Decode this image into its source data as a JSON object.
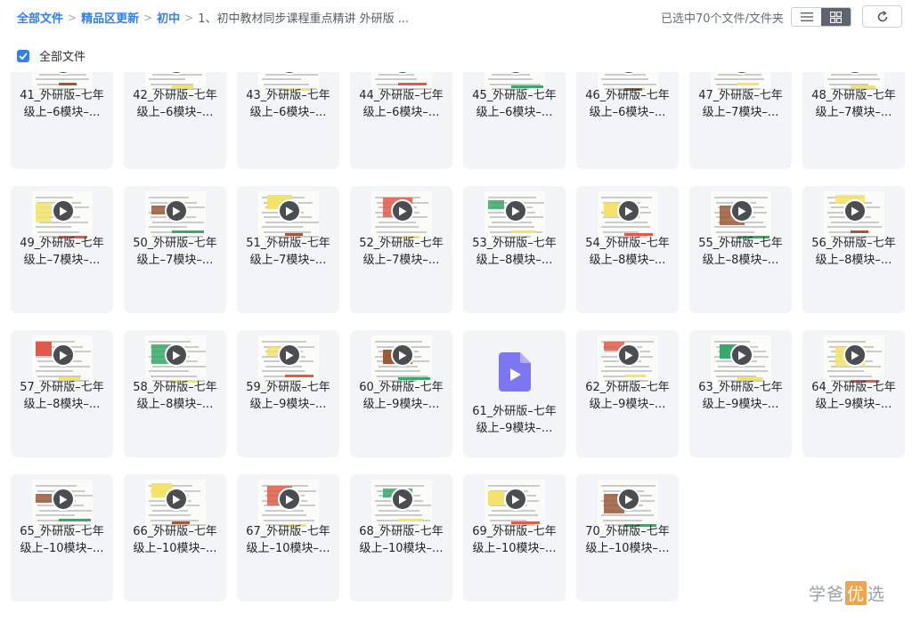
{
  "breadcrumb": [
    {
      "label": "全部文件",
      "link": true
    },
    {
      "label": "精品区更新",
      "link": true
    },
    {
      "label": "初中",
      "link": true
    },
    {
      "label": "1、初中教材同步课程重点精讲 外研版 ...",
      "link": false
    }
  ],
  "selection_info": "已选中70个文件/文件夹",
  "select_all_label": "全部文件",
  "view_mode": "grid",
  "accent_color": "#2f7ff0",
  "files": [
    {
      "name": "41_外研版–七年级上–6模块–...",
      "line1": "41_外研版–七年",
      "line2": "级上–6模块–...",
      "type": "video"
    },
    {
      "name": "42_外研版–七年级上–6模块–...",
      "line1": "42_外研版–七年",
      "line2": "级上–6模块–...",
      "type": "video"
    },
    {
      "name": "43_外研版–七年级上–6模块–...",
      "line1": "43_外研版–七年",
      "line2": "级上–6模块–...",
      "type": "video"
    },
    {
      "name": "44_外研版–七年级上–6模块–...",
      "line1": "44_外研版–七年",
      "line2": "级上–6模块–...",
      "type": "video"
    },
    {
      "name": "45_外研版–七年级上–6模块–...",
      "line1": "45_外研版–七年",
      "line2": "级上–6模块–...",
      "type": "video"
    },
    {
      "name": "46_外研版–七年级上–6模块–...",
      "line1": "46_外研版–七年",
      "line2": "级上–6模块–...",
      "type": "video"
    },
    {
      "name": "47_外研版–七年级上–7模块–...",
      "line1": "47_外研版–七年",
      "line2": "级上–7模块–...",
      "type": "video"
    },
    {
      "name": "48_外研版–七年级上–7模块–...",
      "line1": "48_外研版–七年",
      "line2": "级上–7模块–...",
      "type": "video"
    },
    {
      "name": "49_外研版–七年级上–7模块–...",
      "line1": "49_外研版–七年",
      "line2": "级上–7模块–...",
      "type": "video"
    },
    {
      "name": "50_外研版–七年级上–7模块–...",
      "line1": "50_外研版–七年",
      "line2": "级上–7模块–...",
      "type": "video"
    },
    {
      "name": "51_外研版–七年级上–7模块–...",
      "line1": "51_外研版–七年",
      "line2": "级上–7模块–...",
      "type": "video"
    },
    {
      "name": "52_外研版–七年级上–7模块–...",
      "line1": "52_外研版–七年",
      "line2": "级上–7模块–...",
      "type": "video"
    },
    {
      "name": "53_外研版–七年级上–8模块–...",
      "line1": "53_外研版–七年",
      "line2": "级上–8模块–...",
      "type": "video"
    },
    {
      "name": "54_外研版–七年级上–8模块–...",
      "line1": "54_外研版–七年",
      "line2": "级上–8模块–...",
      "type": "video"
    },
    {
      "name": "55_外研版–七年级上–8模块–...",
      "line1": "55_外研版–七年",
      "line2": "级上–8模块–...",
      "type": "video"
    },
    {
      "name": "56_外研版–七年级上–8模块–...",
      "line1": "56_外研版–七年",
      "line2": "级上–8模块–...",
      "type": "video"
    },
    {
      "name": "57_外研版–七年级上–8模块–...",
      "line1": "57_外研版–七年",
      "line2": "级上–8模块–...",
      "type": "video"
    },
    {
      "name": "58_外研版–七年级上–8模块–...",
      "line1": "58_外研版–七年",
      "line2": "级上–8模块–...",
      "type": "video"
    },
    {
      "name": "59_外研版–七年级上–9模块–...",
      "line1": "59_外研版–七年",
      "line2": "级上–9模块–...",
      "type": "video"
    },
    {
      "name": "60_外研版–七年级上–9模块–...",
      "line1": "60_外研版–七年",
      "line2": "级上–9模块–...",
      "type": "video"
    },
    {
      "name": "61_外研版–七年级上–9模块–...",
      "line1": "61_外研版–七年",
      "line2": "级上–9模块–...",
      "type": "video-file"
    },
    {
      "name": "62_外研版–七年级上–9模块–...",
      "line1": "62_外研版–七年",
      "line2": "级上–9模块–...",
      "type": "video"
    },
    {
      "name": "63_外研版–七年级上–9模块–...",
      "line1": "63_外研版–七年",
      "line2": "级上–9模块–...",
      "type": "video"
    },
    {
      "name": "64_外研版–七年级上–9模块–...",
      "line1": "64_外研版–七年",
      "line2": "级上–9模块–...",
      "type": "video"
    },
    {
      "name": "65_外研版–七年级上–10模块–...",
      "line1": "65_外研版–七年",
      "line2": "级上–10模块–...",
      "type": "video"
    },
    {
      "name": "66_外研版–七年级上–10模块–...",
      "line1": "66_外研版–七年",
      "line2": "级上–10模块–...",
      "type": "video"
    },
    {
      "name": "67_外研版–七年级上–10模块–...",
      "line1": "67_外研版–七年",
      "line2": "级上–10模块–...",
      "type": "video"
    },
    {
      "name": "68_外研版–七年级上–10模块–...",
      "line1": "68_外研版–七年",
      "line2": "级上–10模块–...",
      "type": "video"
    },
    {
      "name": "69_外研版–七年级上–10模块–...",
      "line1": "69_外研版–七年",
      "line2": "级上–10模块–...",
      "type": "video"
    },
    {
      "name": "70_外研版–七年级上–10模块–...",
      "line1": "70_外研版–七年",
      "line2": "级上–10模块–...",
      "type": "video"
    }
  ],
  "watermark": {
    "text_left": "学爸",
    "text_accent": "优",
    "text_right": "选"
  }
}
